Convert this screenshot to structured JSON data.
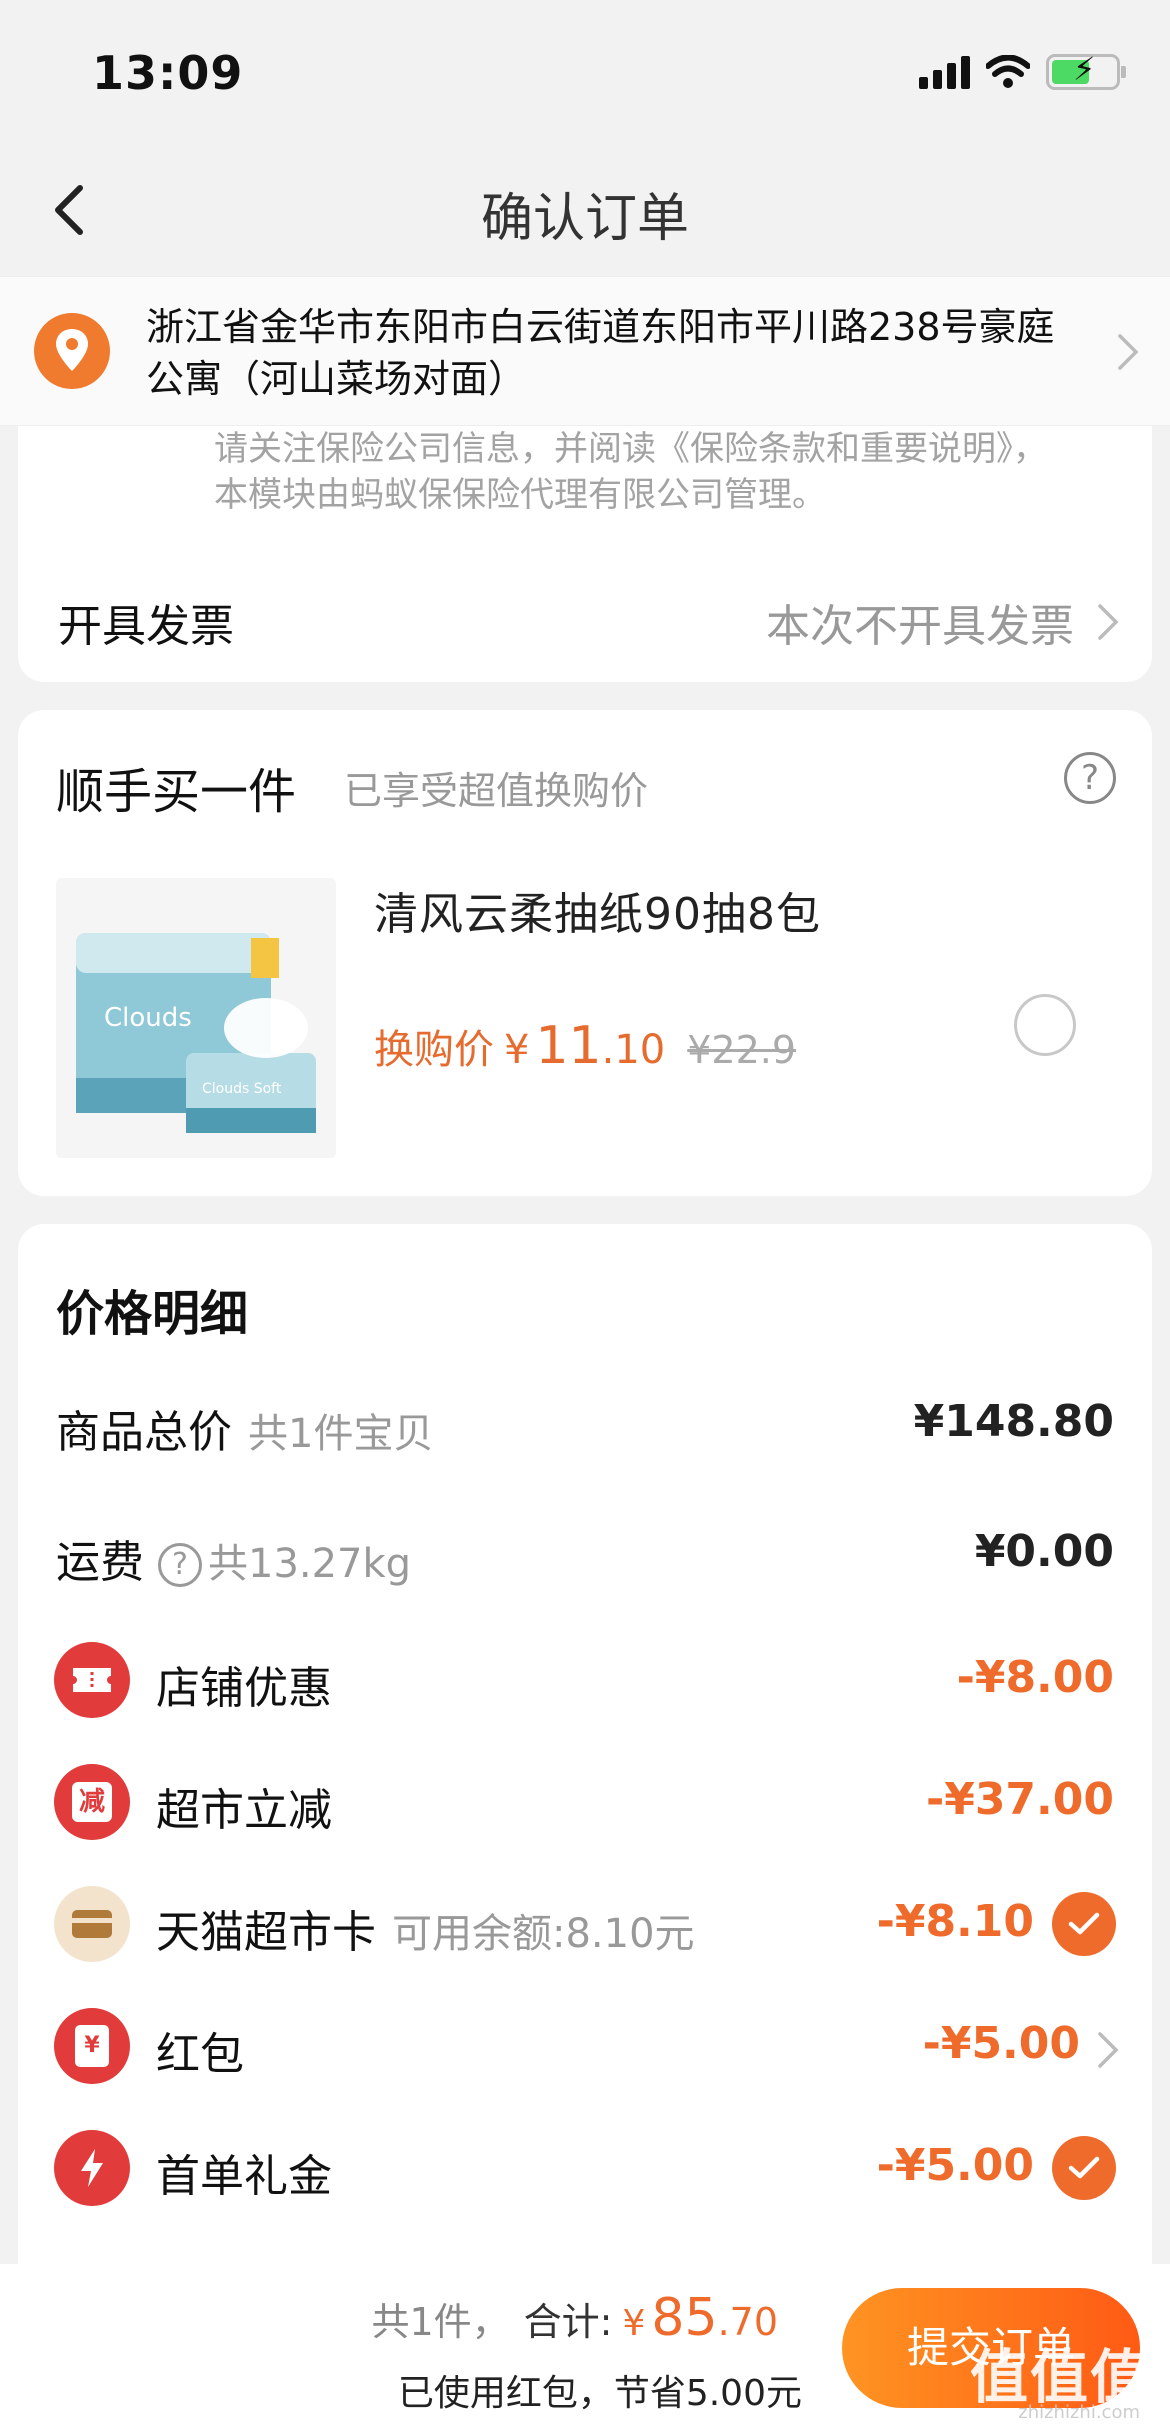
{
  "status_bar": {
    "time": "13:09"
  },
  "nav": {
    "title": "确认订单"
  },
  "address": {
    "text": "浙江省金华市东阳市白云街道东阳市平川路238号豪庭公寓（河山菜场对面）"
  },
  "insurance_note": "请关注保险公司信息，并阅读《保险条款和重要说明》，本模块由蚂蚁保保险代理有限公司管理。",
  "invoice": {
    "label": "开具发票",
    "value": "本次不开具发票"
  },
  "addon": {
    "title": "顺手买一件",
    "subtitle": "已享受超值换购价",
    "help": "?",
    "product_name": "清风云柔抽纸90抽8包",
    "image_text_main": "Clouds",
    "image_text_small": "Clouds Soft",
    "deal_label": "换购价",
    "currency": "¥",
    "deal_int": "11",
    "deal_dec": ".10",
    "original_price": "¥22.9"
  },
  "price_details": {
    "heading": "价格明细",
    "goods_label": "商品总价",
    "goods_sub": "共1件宝贝",
    "goods_amount": "¥148.80",
    "shipping_label": "运费",
    "shipping_help": "?",
    "shipping_sub": "共13.27kg",
    "shipping_amount": "¥0.00",
    "discounts": [
      {
        "label": "店铺优惠",
        "amount": "-¥8.00",
        "icon": "ticket-icon",
        "color": "#e23b3b"
      },
      {
        "label": "超市立减",
        "amount": "-¥37.00",
        "icon": "reduce-icon",
        "badge_text": "减",
        "color": "#e23b3b"
      },
      {
        "label": "天猫超市卡",
        "sub": "可用余额:8.10元",
        "amount": "-¥8.10",
        "icon": "card-icon",
        "color": "#f0e0c8"
      },
      {
        "label": "红包",
        "amount": "-¥5.00",
        "icon": "red-packet-icon",
        "badge_text": "¥",
        "color": "#e23b3b"
      },
      {
        "label": "首单礼金",
        "amount": "-¥5.00",
        "icon": "lightning-icon",
        "color": "#e23b3b"
      }
    ]
  },
  "bottom": {
    "count": "共1件，",
    "total_label": "合计:",
    "currency": "¥",
    "total_int": "85",
    "total_dec": ".70",
    "saving": "已使用红包，节省5.00元",
    "submit": "提交订单",
    "watermark": "值值值",
    "watermark_sub": "zhizhizhi.com"
  },
  "colors": {
    "accent": "#ee6b2c",
    "discount_red": "#e23b3b",
    "pin_orange": "#f07b2f"
  }
}
